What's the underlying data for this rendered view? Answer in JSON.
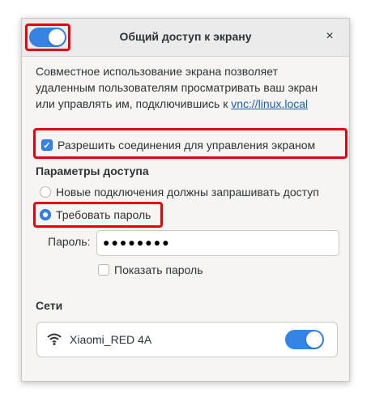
{
  "window": {
    "title": "Общий доступ к экрану",
    "close_glyph": "×",
    "sharing_enabled": true
  },
  "description": {
    "text": "Совместное использование экрана позволяет удаленным пользователям просматривать ваш экран или управлять им, подключившись к ",
    "link": "vnc://linux.local"
  },
  "remote_control": {
    "label": "Разрешить соединения для управления экраном",
    "checked": true
  },
  "access": {
    "heading": "Параметры доступа",
    "options": [
      {
        "label": "Новые подключения должны запрашивать доступ",
        "selected": false
      },
      {
        "label": "Требовать пароль",
        "selected": true
      }
    ],
    "password_label": "Пароль:",
    "password_value": "●●●●●●●●",
    "show_password_label": "Показать пароль",
    "show_password_checked": false
  },
  "networks": {
    "heading": "Сети",
    "items": [
      {
        "name": "Xiaomi_RED 4A",
        "icon": "wifi-icon",
        "enabled": true
      }
    ]
  },
  "colors": {
    "accent": "#3584e4",
    "highlight": "#e3000f"
  }
}
